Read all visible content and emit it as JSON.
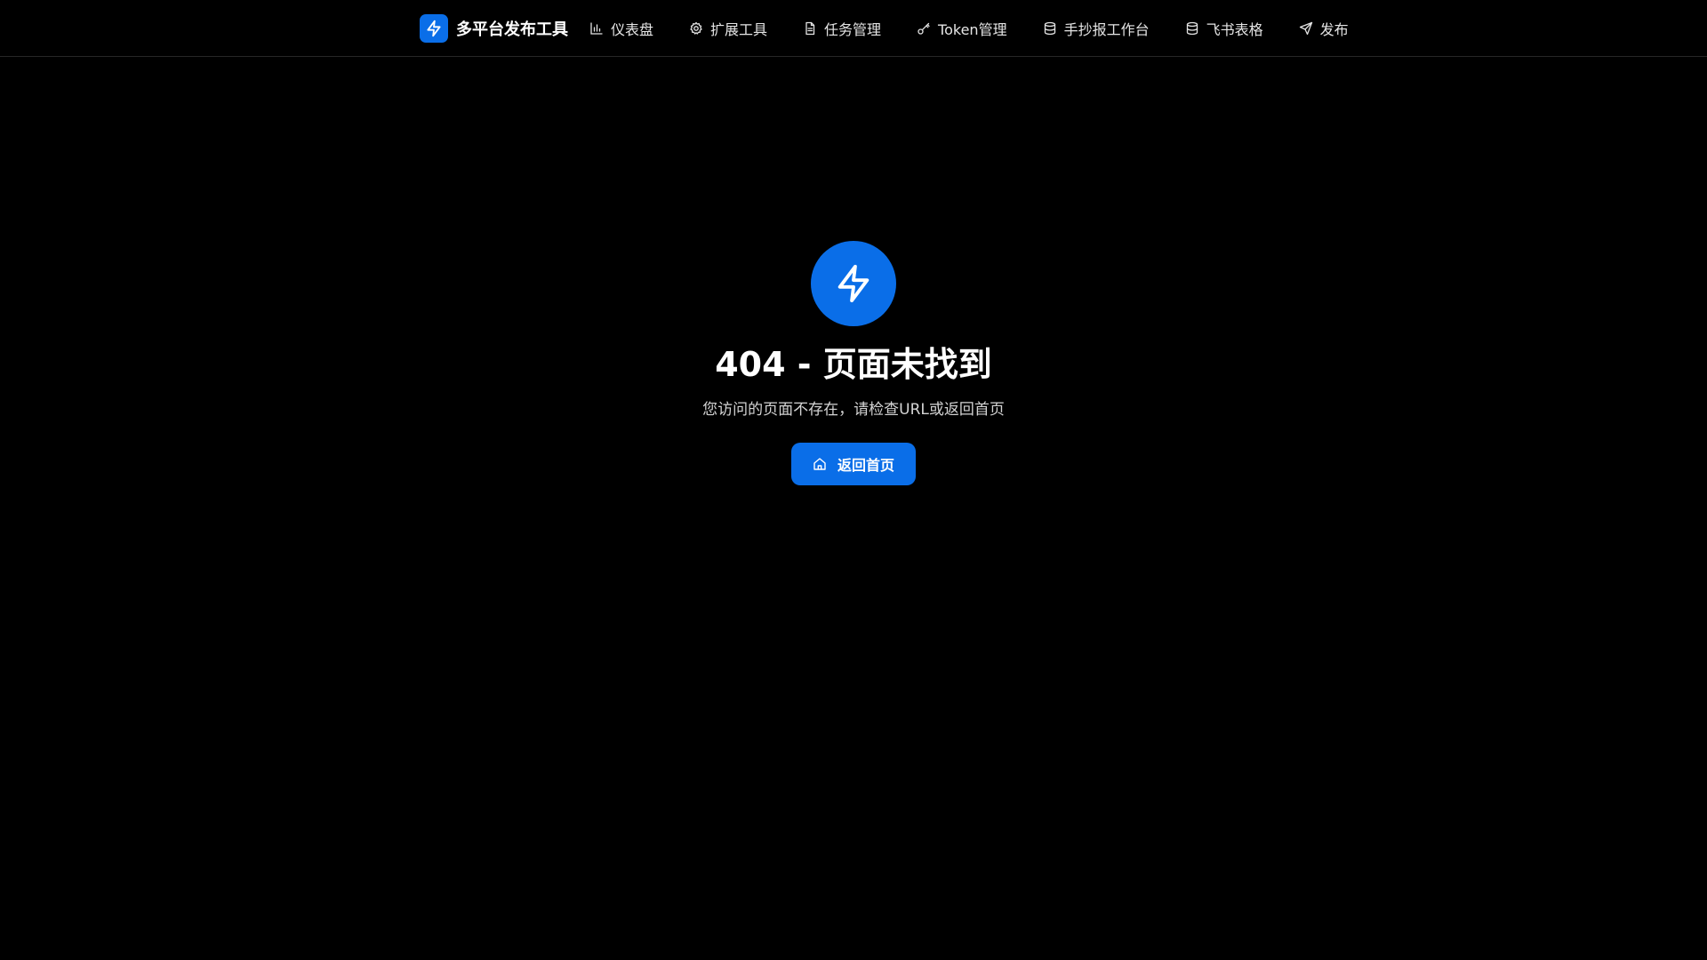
{
  "colors": {
    "accent": "#0a6ee8",
    "background": "#000000",
    "text": "#ffffff",
    "muted": "#d4d4d4"
  },
  "header": {
    "brand": {
      "name": "多平台发布工具",
      "icon": "lightning-bolt-icon"
    },
    "nav": [
      {
        "label": "仪表盘",
        "icon": "bar-chart-icon"
      },
      {
        "label": "扩展工具",
        "icon": "gear-icon"
      },
      {
        "label": "任务管理",
        "icon": "file-text-icon"
      },
      {
        "label": "Token管理",
        "icon": "key-icon"
      },
      {
        "label": "手抄报工作台",
        "icon": "database-icon"
      },
      {
        "label": "飞书表格",
        "icon": "database-icon"
      },
      {
        "label": "发布",
        "icon": "send-icon"
      }
    ]
  },
  "not_found": {
    "icon": "lightning-bolt-icon",
    "title": "404 - 页面未找到",
    "message": "您访问的页面不存在，请检查URL或返回首页",
    "home_button": {
      "label": "返回首页",
      "icon": "home-icon"
    }
  }
}
